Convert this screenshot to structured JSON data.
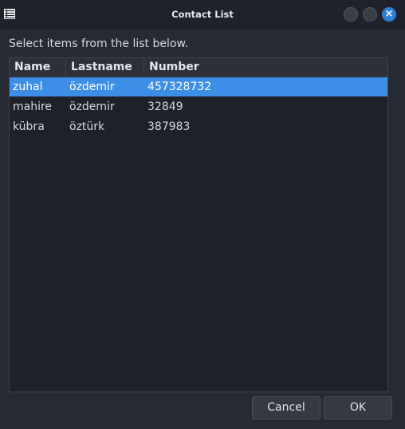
{
  "window": {
    "title": "Contact List"
  },
  "dialog": {
    "prompt": "Select items from the list below."
  },
  "table": {
    "columns": [
      "Name",
      "Lastname",
      "Number"
    ],
    "rows": [
      {
        "name": "zuhal",
        "lastname": "özdemir",
        "number": "457328732",
        "selected": true
      },
      {
        "name": "mahire",
        "lastname": "özdemir",
        "number": "32849",
        "selected": false
      },
      {
        "name": "kübra",
        "lastname": "öztürk",
        "number": "387983",
        "selected": false
      }
    ]
  },
  "buttons": {
    "cancel": "Cancel",
    "ok": "OK"
  },
  "colors": {
    "selection": "#3d8ee6",
    "close_button": "#2f7fd8"
  },
  "icons": {
    "app": "list-icon",
    "close": "close-icon"
  }
}
